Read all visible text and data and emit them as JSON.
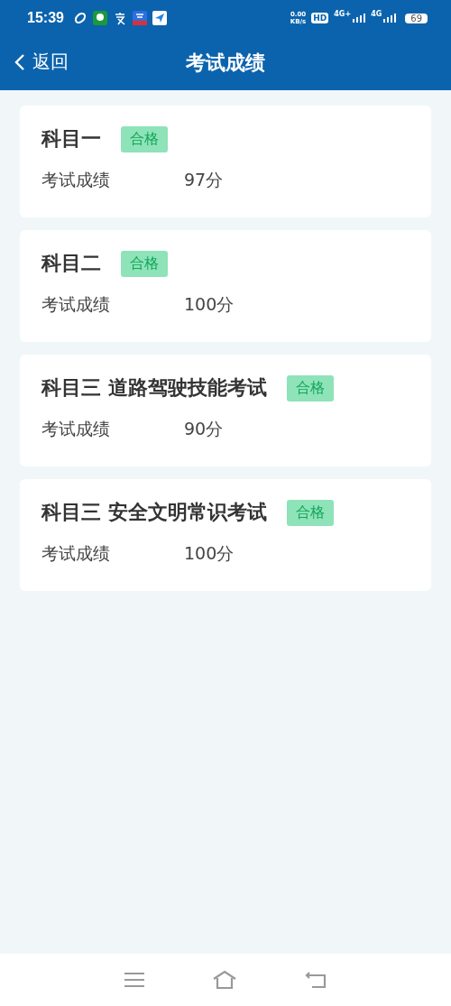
{
  "status_bar": {
    "time": "15:39",
    "speed": "0.00",
    "speed_unit": "KB/s",
    "hd": "HD",
    "sim_1": "4G+",
    "sim_2": "4G",
    "battery": "69"
  },
  "header": {
    "back": "返回",
    "title": "考试成绩"
  },
  "results": [
    {
      "subject": "科目一",
      "badge": "合格",
      "label": "考试成绩",
      "score": "97分"
    },
    {
      "subject": "科目二",
      "badge": "合格",
      "label": "考试成绩",
      "score": "100分"
    },
    {
      "subject": "科目三 道路驾驶技能考试",
      "badge": "合格",
      "label": "考试成绩",
      "score": "90分"
    },
    {
      "subject": "科目三 安全文明常识考试",
      "badge": "合格",
      "label": "考试成绩",
      "score": "100分"
    }
  ]
}
